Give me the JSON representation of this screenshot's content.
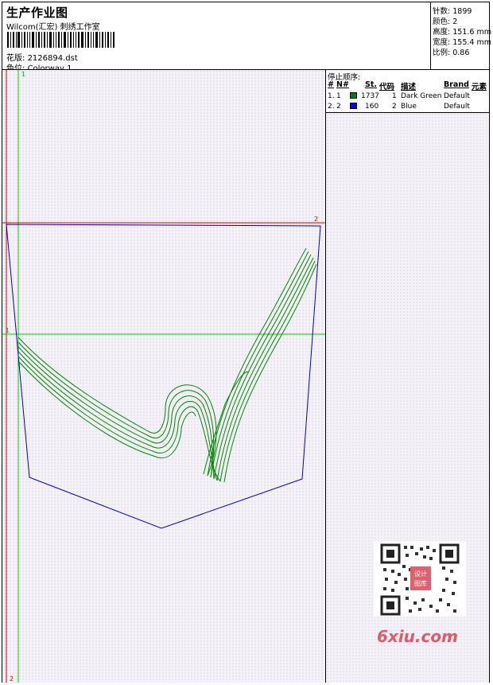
{
  "header": {
    "title": "生产作业图",
    "studio": "Wilcom(汇宏) 刺绣工作室",
    "filename_label": "花版:",
    "filename": "2126894.dst",
    "colorway_label": "色位:",
    "colorway": "Colorway 1"
  },
  "stats": {
    "stitches_label": "针数:",
    "stitches": "1899",
    "colors_label": "颜色:",
    "colors": "2",
    "height_label": "高度:",
    "height": "151.6 mm",
    "width_label": "宽度:",
    "width": "155.4 mm",
    "scale_label": "比例:",
    "scale": "0.86"
  },
  "stop_sequence": {
    "title": "停止顺序:",
    "headers": [
      "#",
      "N#",
      "St.",
      "代码",
      "描述",
      "Brand",
      "元素"
    ],
    "rows": [
      {
        "num": "1.",
        "n": "1",
        "color": "#008000",
        "stitches": "1737",
        "code": "1",
        "desc": "Dark Green",
        "brand": "Default"
      },
      {
        "num": "2.",
        "n": "2",
        "color": "#0000ff",
        "stitches": "160",
        "code": "2",
        "desc": "Blue",
        "brand": "Default"
      }
    ]
  },
  "canvas": {
    "marker_1": "1",
    "marker_2": "2",
    "guide_colors": {
      "green": "#00cc00",
      "red": "#dd0000",
      "blue": "#0000cc",
      "thread_green": "#008800"
    }
  },
  "watermark": {
    "site": "6xiu.com",
    "stamp": "设计图库"
  }
}
